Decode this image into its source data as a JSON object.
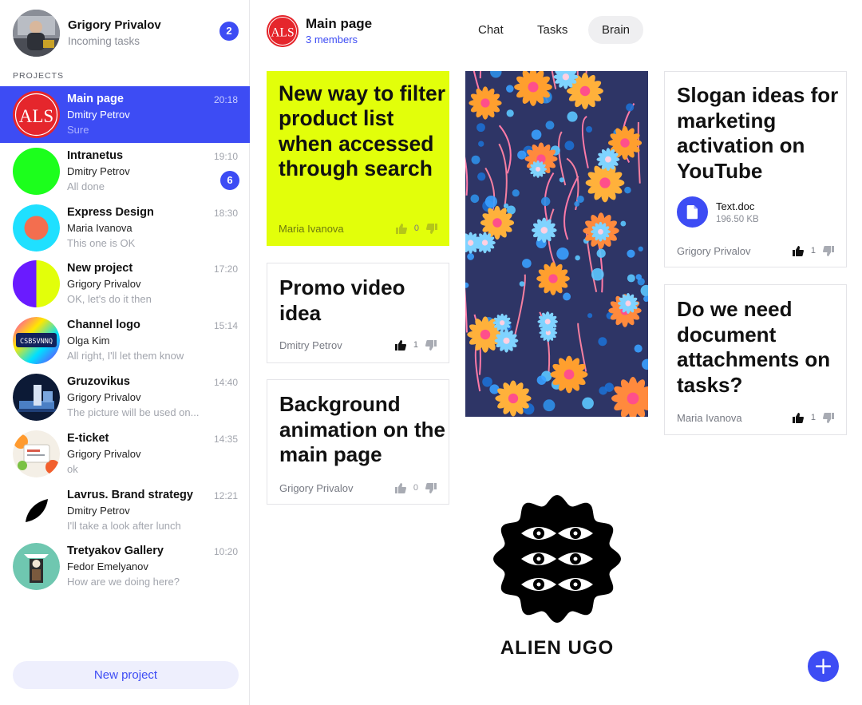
{
  "user": {
    "name": "Grigory Privalov",
    "subtitle": "Incoming tasks",
    "badge": "2"
  },
  "sidebar": {
    "section_label": "PROJECTS",
    "projects": [
      {
        "title": "Main page",
        "person": "Dmitry Petrov",
        "message": "Sure",
        "time": "20:18",
        "avatar_text": "ALS"
      },
      {
        "title": "Intranetus",
        "person": "Dmitry Petrov",
        "message": "All done",
        "time": "19:10",
        "badge": "6"
      },
      {
        "title": "Express Design",
        "person": "Maria Ivanova",
        "message": "This one is OK",
        "time": "18:30"
      },
      {
        "title": "New project",
        "person": "Grigory Privalov",
        "message": "OK, let's do it then",
        "time": "17:20"
      },
      {
        "title": "Channel logo",
        "person": "Olga Kim",
        "message": "All right, I'll let them know",
        "time": "15:14",
        "avatar_text": "CSBSVNNQ"
      },
      {
        "title": "Gruzovikus",
        "person": "Grigory Privalov",
        "message": "The picture will be used on...",
        "time": "14:40"
      },
      {
        "title": "E-ticket",
        "person": "Grigory Privalov",
        "message": "ok",
        "time": "14:35"
      },
      {
        "title": "Lavrus. Brand strategy",
        "person": "Dmitry Petrov",
        "message": "I'll take a look after lunch",
        "time": "12:21"
      },
      {
        "title": "Tretyakov Gallery",
        "person": "Fedor Emelyanov",
        "message": "How are we doing here?",
        "time": "10:20"
      }
    ],
    "new_project_label": "New project"
  },
  "header": {
    "avatar_text": "ALS",
    "title": "Main page",
    "members": "3 members",
    "tabs": [
      {
        "label": "Chat",
        "active": false
      },
      {
        "label": "Tasks",
        "active": false
      },
      {
        "label": "Brain",
        "active": true
      }
    ]
  },
  "cards": [
    {
      "title": "New way to filter product list when accessed through search",
      "author": "Maria Ivanova",
      "votes": "0"
    },
    {
      "title": "Promo video idea",
      "author": "Dmitry Petrov",
      "votes": "1"
    },
    {
      "title": "Background animation on the main page",
      "author": "Grigory Privalov",
      "votes": "0"
    },
    {
      "title": "Slogan ideas for marketing activation on YouTube",
      "author": "Grigory Privalov",
      "votes": "1",
      "file": {
        "name": "Text.doc",
        "size": "196.50 KB"
      }
    },
    {
      "title": "Do we need document attachments on tasks?",
      "author": "Maria Ivanova",
      "votes": "1"
    }
  ],
  "logo_text": "ALIEN UGO",
  "icons": {
    "fab": "plus-icon",
    "file": "document-icon",
    "vote_up": "thumbs-up-icon",
    "vote_down": "thumbs-down-icon"
  },
  "colors": {
    "accent": "#3d4cf4",
    "highlight_card": "#e2ff0a",
    "brand_red": "#e5262c"
  }
}
